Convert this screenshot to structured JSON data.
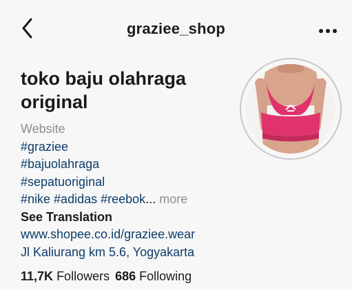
{
  "header": {
    "username": "graziee_shop"
  },
  "profile": {
    "name_line1": "toko baju olahraga",
    "name_line2": "original",
    "category": "Website",
    "bio": {
      "tag1": "#graziee",
      "tag2": "#bajuolahraga",
      "tag3": "#sepatuoriginal",
      "tag4": "#nike",
      "tag5": "#adidas",
      "tag6": "#reebok",
      "ellipsis": "...",
      "more": "more"
    },
    "see_translation": "See Translation",
    "website": "www.shopee.co.id/graziee.wear",
    "address": "Jl Kaliurang km 5.6, Yogyakarta"
  },
  "stats": {
    "followers_count": "11,7K",
    "followers_label": "Followers",
    "following_count": "686",
    "following_label": "Following"
  },
  "colors": {
    "background": "#f7f7f7",
    "link": "#0d3c6b",
    "muted": "#8e8e8e",
    "sports_bra": "#e0336b"
  },
  "icons": {
    "back": "chevron-left-icon",
    "more": "more-horizontal-icon"
  }
}
